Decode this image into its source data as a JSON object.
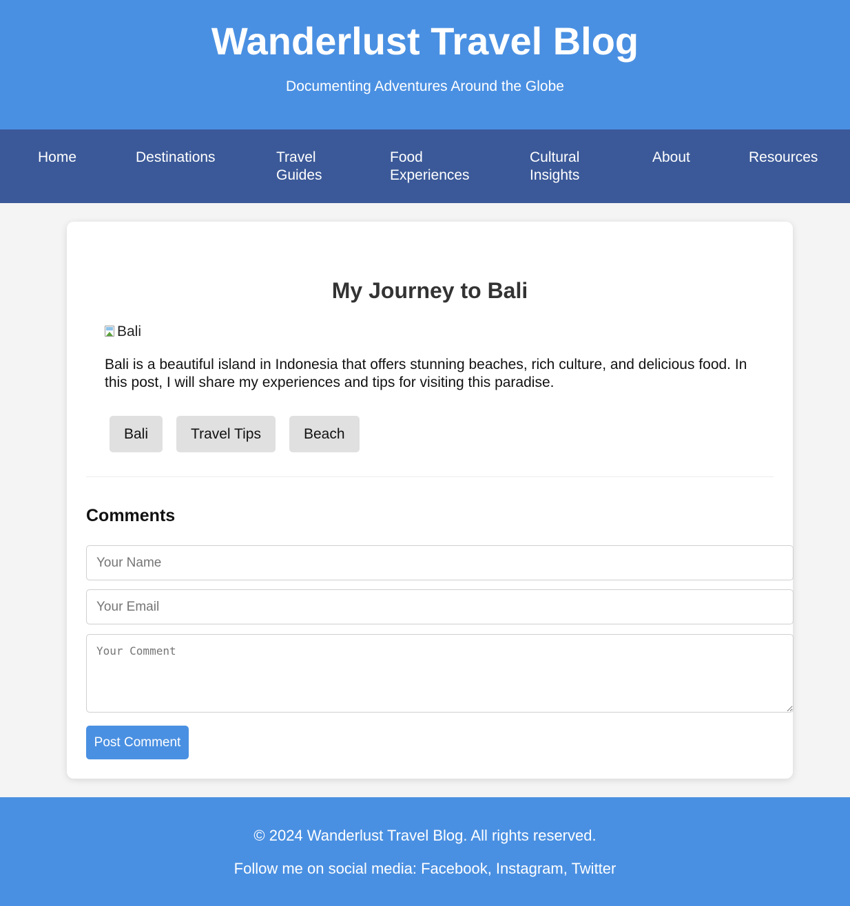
{
  "header": {
    "title": "Wanderlust Travel Blog",
    "subtitle": "Documenting Adventures Around the Globe"
  },
  "nav": {
    "items": [
      {
        "label": "Home"
      },
      {
        "label": "Destinations"
      },
      {
        "label": "Travel\nGuides"
      },
      {
        "label": "Food\nExperiences"
      },
      {
        "label": "Cultural\nInsights"
      },
      {
        "label": "About"
      },
      {
        "label": "Resources"
      }
    ]
  },
  "post": {
    "title": "My Journey to Bali",
    "image_alt": "Bali",
    "body": "Bali is a beautiful island in Indonesia that offers stunning beaches, rich culture, and delicious food. In this post, I will share my experiences and tips for visiting this paradise.",
    "tags": [
      "Bali",
      "Travel Tips",
      "Beach"
    ]
  },
  "comments": {
    "title": "Comments",
    "name_placeholder": "Your Name",
    "email_placeholder": "Your Email",
    "comment_placeholder": "Your Comment",
    "submit_label": "Post Comment"
  },
  "footer": {
    "copyright": "© 2024 Wanderlust Travel Blog. All rights reserved.",
    "social": "Follow me on social media: Facebook, Instagram, Twitter"
  },
  "colors": {
    "header_bg": "#4a90e2",
    "nav_bg": "#3b5998",
    "page_bg": "#f4f4f4",
    "tag_bg": "#e0e0e0",
    "button_bg": "#4a90e2"
  }
}
